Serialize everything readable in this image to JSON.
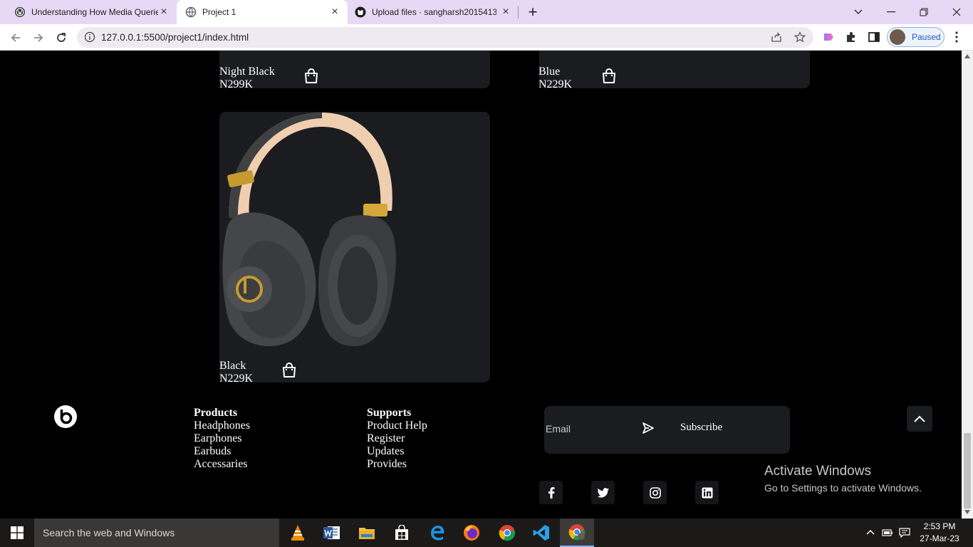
{
  "browser": {
    "tabs": [
      {
        "title": "Understanding How Media Querie",
        "active": false
      },
      {
        "title": "Project 1",
        "active": true
      },
      {
        "title": "Upload files · sangharsh2015413/",
        "active": false
      }
    ],
    "url": "127.0.0.1:5500/project1/index.html",
    "profile_status": "Paused"
  },
  "products": [
    {
      "name": "Night Black",
      "price": "N299K"
    },
    {
      "name": "Blue",
      "price": "N229K"
    },
    {
      "name": "Black",
      "price": "N229K"
    }
  ],
  "footer": {
    "columns": [
      {
        "heading": "Products",
        "links": [
          "Headphones",
          "Earphones",
          "Earbuds",
          "Accessaries"
        ]
      },
      {
        "heading": "Supports",
        "links": [
          "Product Help",
          "Register",
          "Updates",
          "Provides"
        ]
      }
    ],
    "subscribe": {
      "placeholder": "Email",
      "button_label": "Subscribe"
    },
    "social": [
      "facebook-icon",
      "twitter-icon",
      "instagram-icon",
      "linkedin-icon"
    ]
  },
  "watermark": {
    "title": "Activate Windows",
    "subtitle": "Go to Settings to activate Windows."
  },
  "taskbar": {
    "search_placeholder": "Search the web and Windows",
    "time": "2:53 PM",
    "date": "27-Mar-23"
  },
  "colors": {
    "card_bg": "#1b1c1f",
    "page_bg": "#000000",
    "tabbar_bg": "#e7d8f5"
  }
}
